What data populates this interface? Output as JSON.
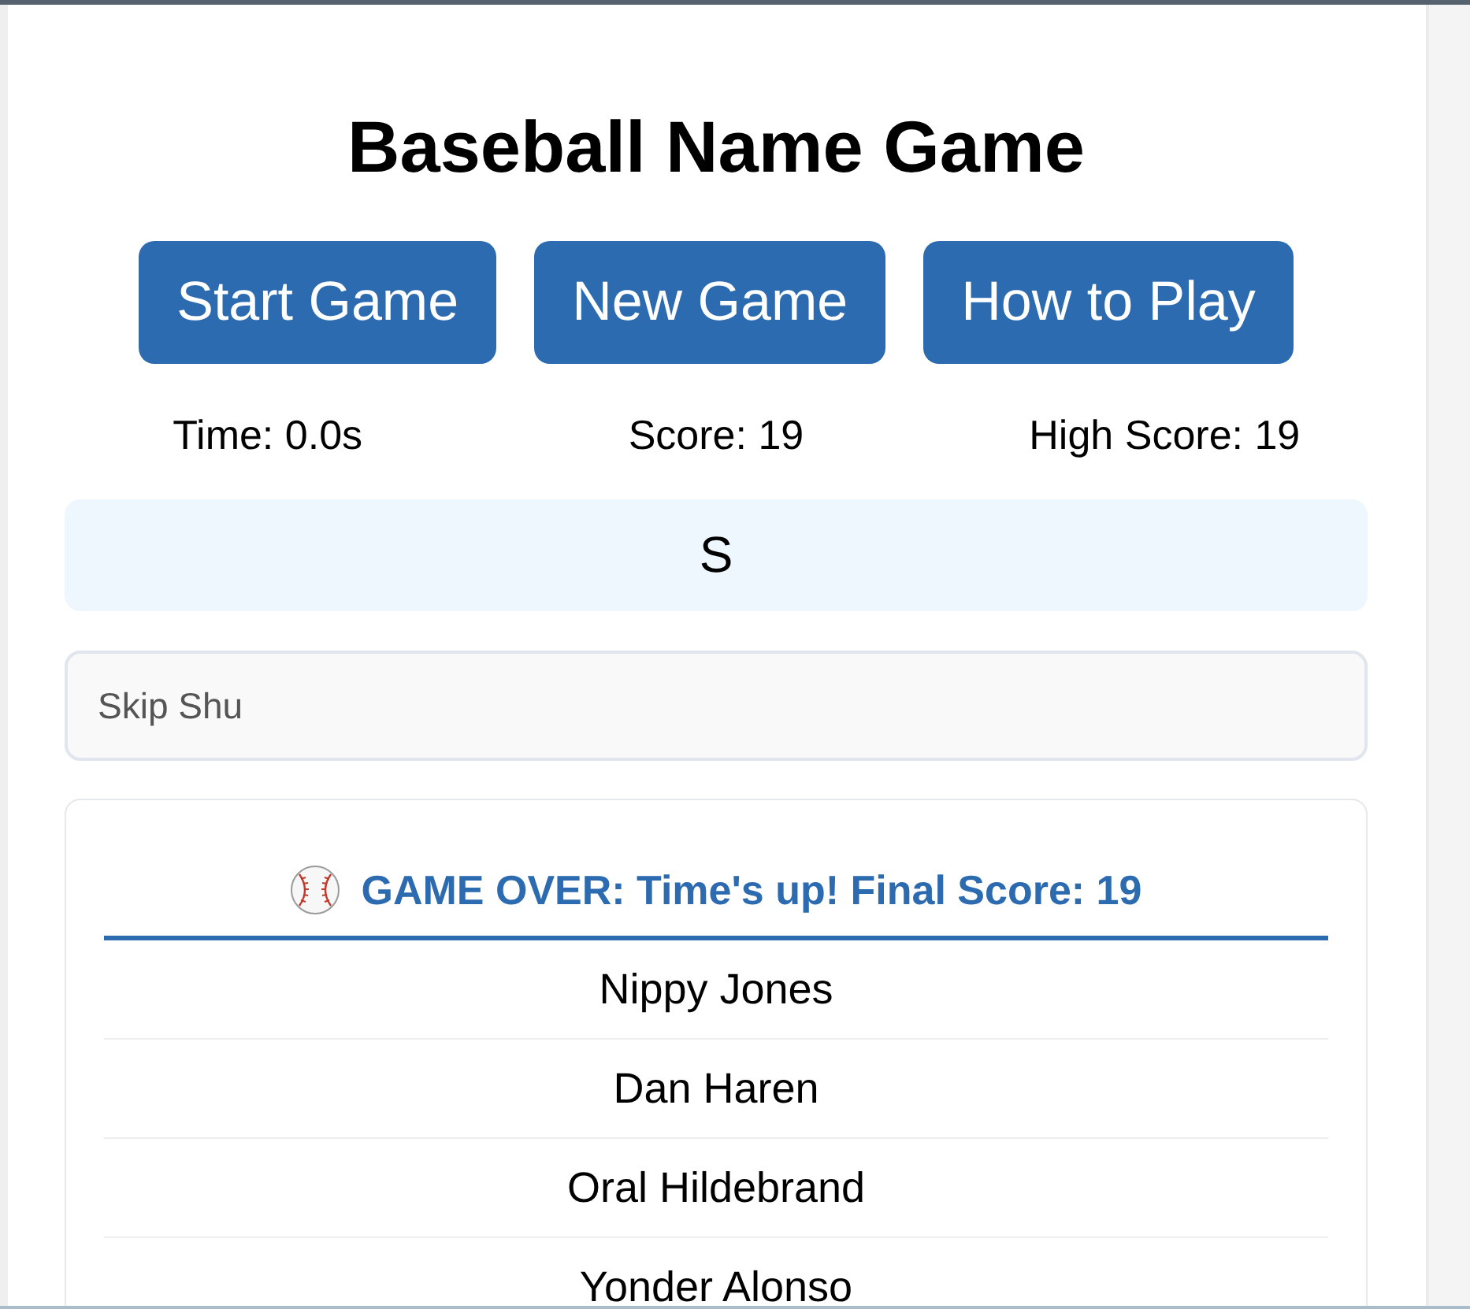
{
  "title": "Baseball Name Game",
  "buttons": [
    {
      "label": "Start Game"
    },
    {
      "label": "New Game"
    },
    {
      "label": "How to Play"
    }
  ],
  "stats": [
    "Time: 0.0s",
    "Score: 19",
    "High Score: 19"
  ],
  "letter": "S",
  "guess_field": {
    "value": "Skip Shu"
  },
  "results": {
    "heading": "GAME OVER: Time's up! Final Score: 19",
    "names": [
      "Nippy Jones",
      "Dan Haren",
      "Oral Hildebrand",
      "Yonder Alonso"
    ]
  }
}
